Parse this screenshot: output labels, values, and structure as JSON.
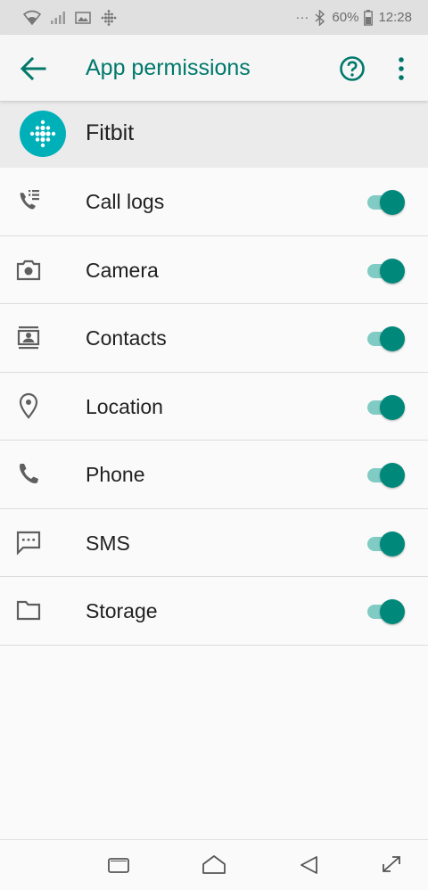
{
  "status_bar": {
    "battery_percent": "60%",
    "time": "12:28",
    "dots": "···",
    "icons": [
      "wifi-icon",
      "signal-icon",
      "image-icon",
      "fitbit-notification-icon",
      "bluetooth-icon",
      "battery-icon"
    ]
  },
  "app_bar": {
    "title": "App permissions",
    "icons": [
      "back-arrow-icon",
      "help-circle-icon",
      "more-vert-icon"
    ],
    "accent_color": "#00796b"
  },
  "app": {
    "name": "Fitbit",
    "logo_color": "#00b0b9"
  },
  "permissions": [
    {
      "label": "Call logs",
      "icon": "call-log-icon",
      "enabled": true
    },
    {
      "label": "Camera",
      "icon": "camera-icon",
      "enabled": true
    },
    {
      "label": "Contacts",
      "icon": "contacts-icon",
      "enabled": true
    },
    {
      "label": "Location",
      "icon": "location-pin-icon",
      "enabled": true
    },
    {
      "label": "Phone",
      "icon": "phone-icon",
      "enabled": true
    },
    {
      "label": "SMS",
      "icon": "sms-icon",
      "enabled": true
    },
    {
      "label": "Storage",
      "icon": "folder-icon",
      "enabled": true
    }
  ],
  "nav_bar": {
    "icons": [
      "recents-icon",
      "home-icon",
      "back-icon",
      "expand-icon"
    ]
  },
  "colors": {
    "switch_thumb": "#00897b",
    "switch_track": "#80cbc4"
  }
}
